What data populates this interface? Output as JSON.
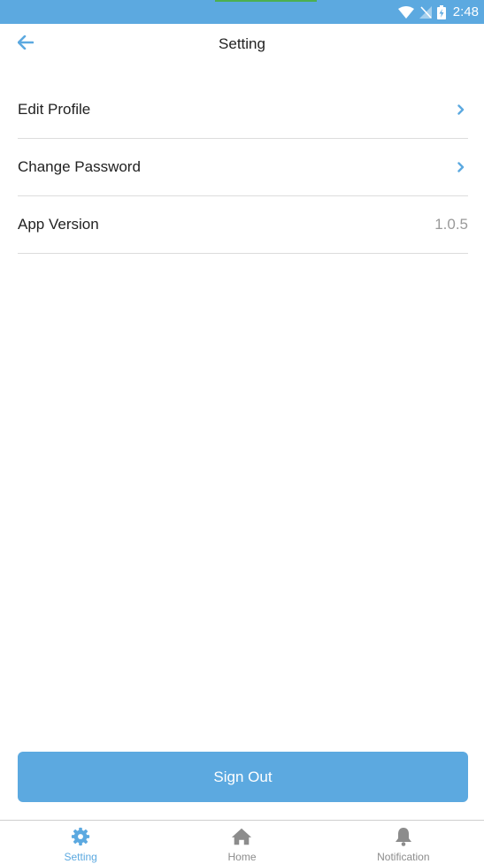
{
  "status_bar": {
    "time": "2:48",
    "icons": [
      "wifi-icon",
      "no-signal-icon",
      "battery-charging-icon"
    ],
    "background_color": "#5ca9e0"
  },
  "header": {
    "title": "Setting",
    "back_icon": "arrow-left-icon",
    "accent_color": "#5ca9e0"
  },
  "settings": {
    "items": [
      {
        "label": "Edit Profile",
        "trailing": "chevron-right-icon"
      },
      {
        "label": "Change Password",
        "trailing": "chevron-right-icon"
      },
      {
        "label": "App Version",
        "value": "1.0.5"
      }
    ]
  },
  "actions": {
    "sign_out_label": "Sign Out",
    "button_color": "#5ca9e0"
  },
  "bottom_nav": {
    "items": [
      {
        "label": "Setting",
        "icon": "gear-icon",
        "active": true
      },
      {
        "label": "Home",
        "icon": "home-icon",
        "active": false
      },
      {
        "label": "Notification",
        "icon": "bell-icon",
        "active": false
      }
    ],
    "active_color": "#5ca9e0",
    "inactive_color": "#8c8c8c"
  }
}
